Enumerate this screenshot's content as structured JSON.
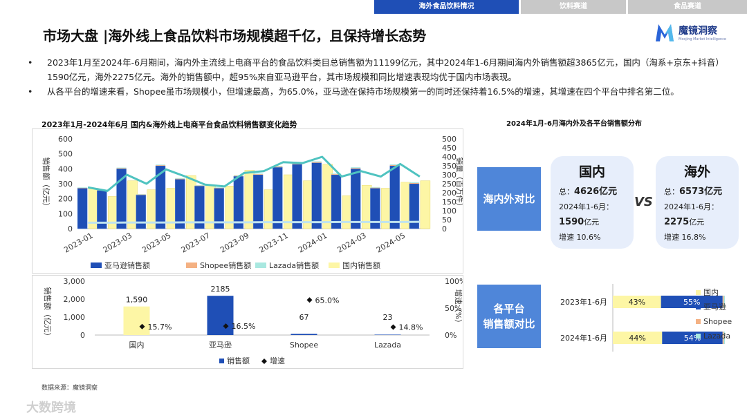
{
  "nav": {
    "tabs": [
      {
        "label": "海外食品饮料情况",
        "active": true
      },
      {
        "label": "饮料赛道",
        "active": false
      },
      {
        "label": "食品赛道",
        "active": false
      }
    ]
  },
  "header": {
    "title": "市场大盘 |海外线上食品饮料市场规模超千亿，且保持增长态势",
    "logo_cn": "魔镜洞察",
    "logo_en": "Moojing Market Intelligence"
  },
  "bullets": [
    "2023年1月至2024年-6月期间，海内外主流线上电商平台的食品饮料类目总销售额为11199亿元，其中2024年1-6月期间海内外销售额超3865亿元，国内（淘系+京东+抖音）1590亿元，海外2275亿元。海外的销售额中，超95%来自亚马逊平台，其市场规模和同比增速表现均优于国内市场表现。",
    "从各平台的增速来看，Shopee虽市场规模小，但增速最高，为65.0%，亚马逊在保持市场规模第一的同时还保持着16.5%的增速，其增速在四个平台中排名第二位。"
  ],
  "colors": {
    "amazon": "#1f4fb6",
    "shopee": "#f4b183",
    "lazada": "#a9e8e0",
    "domestic": "#fdf6a5",
    "line": "#4fc3c0",
    "card_label": "#4f86d9",
    "card_bg": "#e7eefb"
  },
  "chart_data": [
    {
      "type": "bar",
      "title": "2023年1月-2024年6月 国内&海外线上电商平台食品饮料销售额变化趋势",
      "stacked": true,
      "ylabel": "销售额（亿元）",
      "y2label": "销量（百万件）",
      "ylim": [
        0,
        600
      ],
      "y2lim": [
        0,
        500
      ],
      "yticks": [
        "0",
        "100",
        "200",
        "300",
        "400",
        "500",
        "600"
      ],
      "y2ticks": [
        "0",
        "50",
        "100",
        "150",
        "200",
        "250",
        "300",
        "350",
        "400",
        "450",
        "500"
      ],
      "xtick_labels": [
        "2023-01",
        "2023-03",
        "2023-05",
        "2023-07",
        "2023-09",
        "2023-11",
        "2024-01",
        "2024-03",
        "2024-05"
      ],
      "categories": [
        "2023-01",
        "2023-02",
        "2023-03",
        "2023-04",
        "2023-05",
        "2023-06",
        "2023-07",
        "2023-08",
        "2023-09",
        "2023-10",
        "2023-11",
        "2023-12",
        "2024-01",
        "2024-02",
        "2024-03",
        "2024-04",
        "2024-05",
        "2024-06"
      ],
      "series": [
        {
          "name": "亚马逊销售额",
          "group": "overseas",
          "values": [
            270,
            255,
            400,
            225,
            420,
            330,
            285,
            270,
            350,
            360,
            410,
            430,
            440,
            360,
            400,
            270,
            420,
            300
          ]
        },
        {
          "name": "Shopee销售额",
          "group": "overseas",
          "values": [
            3,
            3,
            4,
            3,
            4,
            4,
            3,
            3,
            4,
            4,
            5,
            5,
            5,
            4,
            5,
            4,
            5,
            5
          ]
        },
        {
          "name": "Lazada销售额",
          "group": "overseas",
          "values": [
            3,
            3,
            4,
            3,
            4,
            4,
            3,
            3,
            4,
            4,
            5,
            5,
            5,
            4,
            5,
            4,
            5,
            5
          ]
        },
        {
          "name": "国内销售额",
          "group": "domestic",
          "values": [
            270,
            215,
            320,
            260,
            270,
            355,
            290,
            285,
            390,
            260,
            360,
            320,
            430,
            220,
            290,
            270,
            310,
            320
          ]
        }
      ],
      "line_series": [
        {
          "axis": "right",
          "values": [
            230,
            210,
            300,
            250,
            330,
            290,
            245,
            235,
            310,
            320,
            370,
            365,
            400,
            290,
            320,
            290,
            360,
            290
          ]
        },
        {
          "axis": "right",
          "values": [
            33,
            33,
            34,
            34,
            34,
            35,
            35,
            35,
            35,
            36,
            36,
            36,
            36,
            37,
            37,
            37,
            37,
            38
          ]
        }
      ],
      "legend": {
        "placement": "bottom"
      }
    },
    {
      "type": "bar",
      "ylabel": "销售额（亿元）",
      "y2label": "增速（%）",
      "ylim": [
        0,
        3000
      ],
      "y2lim": [
        0,
        100
      ],
      "yticks": [
        "0",
        "1,000",
        "2,000",
        "3,000"
      ],
      "y2ticks": [
        "0%",
        "50%",
        "100%"
      ],
      "categories": [
        "国内",
        "亚马逊",
        "Shopee",
        "Lazada"
      ],
      "series": [
        {
          "name": "销售额",
          "values": [
            1590,
            2185,
            67,
            23
          ],
          "labels": [
            "1,590",
            "2185",
            "67",
            "23"
          ],
          "colors": [
            "#fdf6a5",
            "#1f4fb6",
            "#1f4fb6",
            "#1f4fb6"
          ]
        }
      ],
      "growth": {
        "name": "增速",
        "values": [
          15.7,
          16.5,
          65.0,
          14.8
        ],
        "labels": [
          "15.7%",
          "16.5%",
          "65.0%",
          "14.8%"
        ]
      },
      "legend": {
        "placement": "bottom"
      }
    },
    {
      "type": "bar",
      "stacked": true,
      "orientation": "horizontal",
      "percent": true,
      "categories": [
        "2023年1-6月",
        "2024年1-6月"
      ],
      "series": [
        {
          "name": "国内",
          "values": [
            43,
            44
          ]
        },
        {
          "name": "亚马逊",
          "values": [
            55,
            54
          ]
        },
        {
          "name": "Shopee",
          "values": [
            1,
            1
          ]
        },
        {
          "name": "Lazada",
          "values": [
            1,
            1
          ]
        }
      ],
      "legend": {
        "placement": "right"
      }
    }
  ],
  "dist_title": "2024年1月-6月海内外及各平台销售额分布",
  "compare": {
    "label1": "海内外对比",
    "label2": [
      "各平台",
      "销售额对比"
    ],
    "vs": "VS",
    "domestic": {
      "name": "国内",
      "total_prefix": "总：",
      "total": "4626亿元",
      "period": "2024年1-6月：",
      "value": "1590",
      "unit": "亿元",
      "growth": "增速 10.6%"
    },
    "overseas": {
      "name": "海外",
      "total_prefix": "总：",
      "total": "6573亿元",
      "period": "2024年1-6月：",
      "value": "2275",
      "unit": "亿元",
      "growth": "增速 16.8%"
    }
  },
  "source": "数据来源：魔镜洞察",
  "watermark": "大数跨境"
}
